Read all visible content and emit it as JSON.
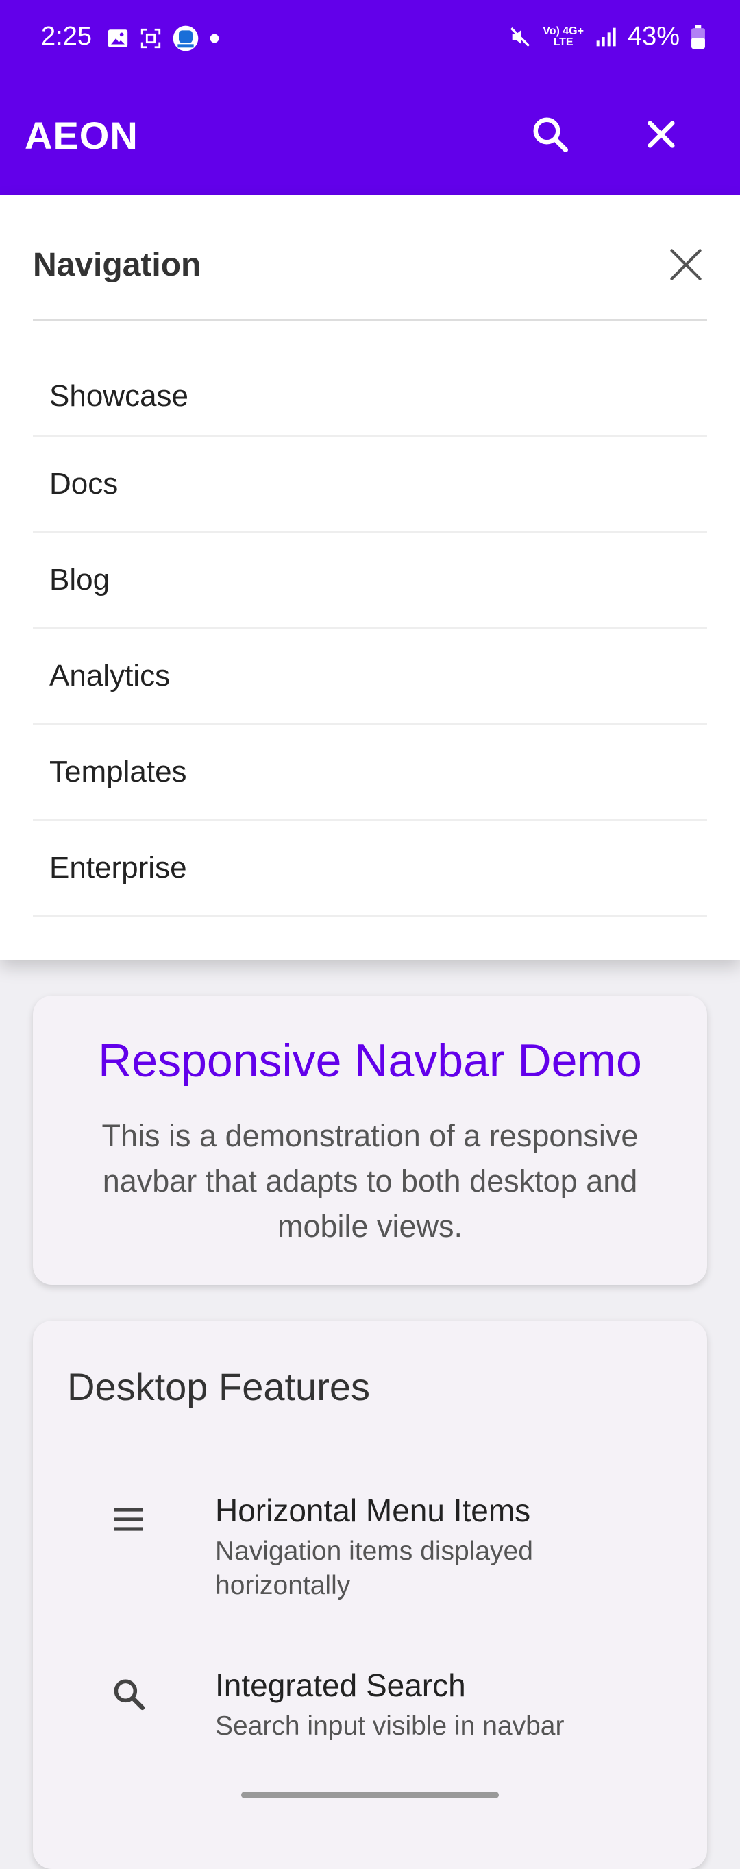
{
  "status_bar": {
    "time": "2:25",
    "battery": "43%",
    "network_top": "Vo) 4G+",
    "network_bottom": "LTE",
    "icons": [
      "image-icon",
      "screenshot-icon",
      "app-icon",
      "dot-icon",
      "mute-icon",
      "signal-icon",
      "battery-icon"
    ]
  },
  "app_bar": {
    "brand": "AEON",
    "icons": [
      "search-icon",
      "close-icon"
    ]
  },
  "drawer": {
    "title": "Navigation",
    "items": [
      {
        "label": "Showcase"
      },
      {
        "label": "Docs"
      },
      {
        "label": "Blog"
      },
      {
        "label": "Analytics"
      },
      {
        "label": "Templates"
      },
      {
        "label": "Enterprise"
      }
    ]
  },
  "demo_card": {
    "title": "Responsive Navbar Demo",
    "description": "This is a demonstration of a responsive navbar that adapts to both desktop and mobile views."
  },
  "features": {
    "heading": "Desktop Features",
    "items": [
      {
        "icon": "menu-icon",
        "title": "Horizontal Menu Items",
        "subtitle": "Navigation items displayed horizontally"
      },
      {
        "icon": "search-icon",
        "title": "Integrated Search",
        "subtitle": "Search input visible in navbar"
      }
    ]
  },
  "colors": {
    "primary": "#6200ea",
    "surface": "#f5f2f7",
    "background": "#f0eff3"
  }
}
